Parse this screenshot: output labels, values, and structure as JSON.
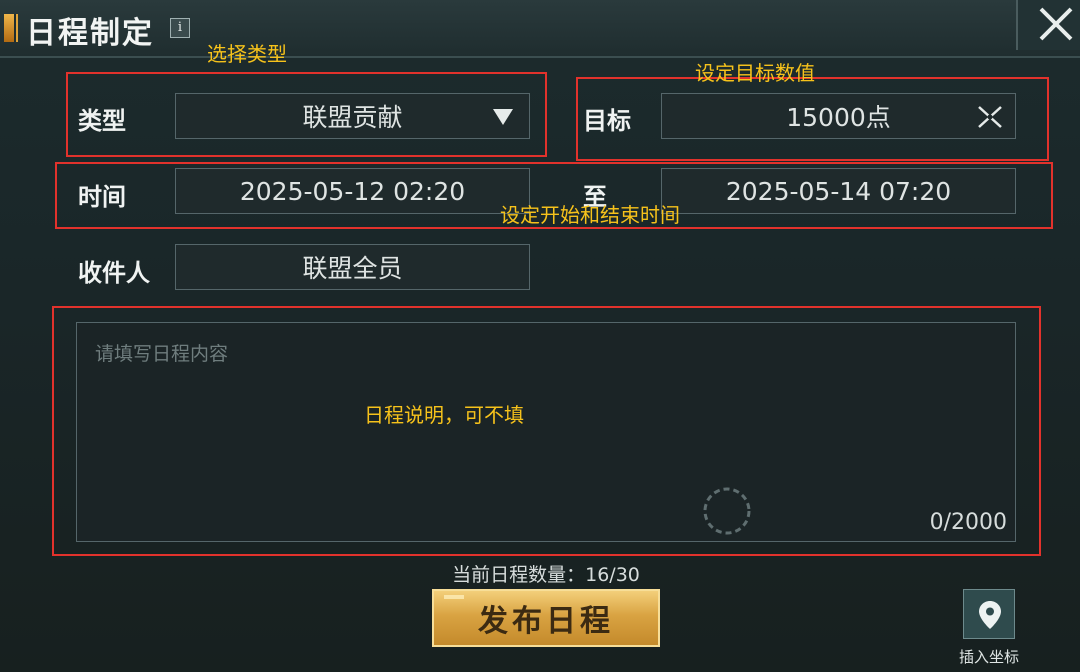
{
  "header": {
    "title": "日程制定",
    "info_icon": "i",
    "close_icon": "close-x-icon"
  },
  "form": {
    "type_label": "类型",
    "type_value": "联盟贡献",
    "target_label": "目标",
    "target_value": "15000点",
    "time_label": "时间",
    "start_time": "2025-05-12 02:20",
    "to_label": "至",
    "end_time": "2025-05-14 07:20",
    "recipient_label": "收件人",
    "recipient_value": "联盟全员",
    "content_placeholder": "请填写日程内容",
    "char_counter": "0/2000"
  },
  "annotations": {
    "select_type": "选择类型",
    "set_target": "设定目标数值",
    "set_time": "设定开始和结束时间",
    "description_optional": "日程说明，可不填"
  },
  "footer": {
    "schedule_count": "当前日程数量：16/30",
    "publish_label": "发布日程",
    "insert_label": "插入坐标"
  },
  "colors": {
    "annotation_border": "#e2322c",
    "annotation_text": "#f6c21b",
    "button_gold": "#d9a342"
  }
}
